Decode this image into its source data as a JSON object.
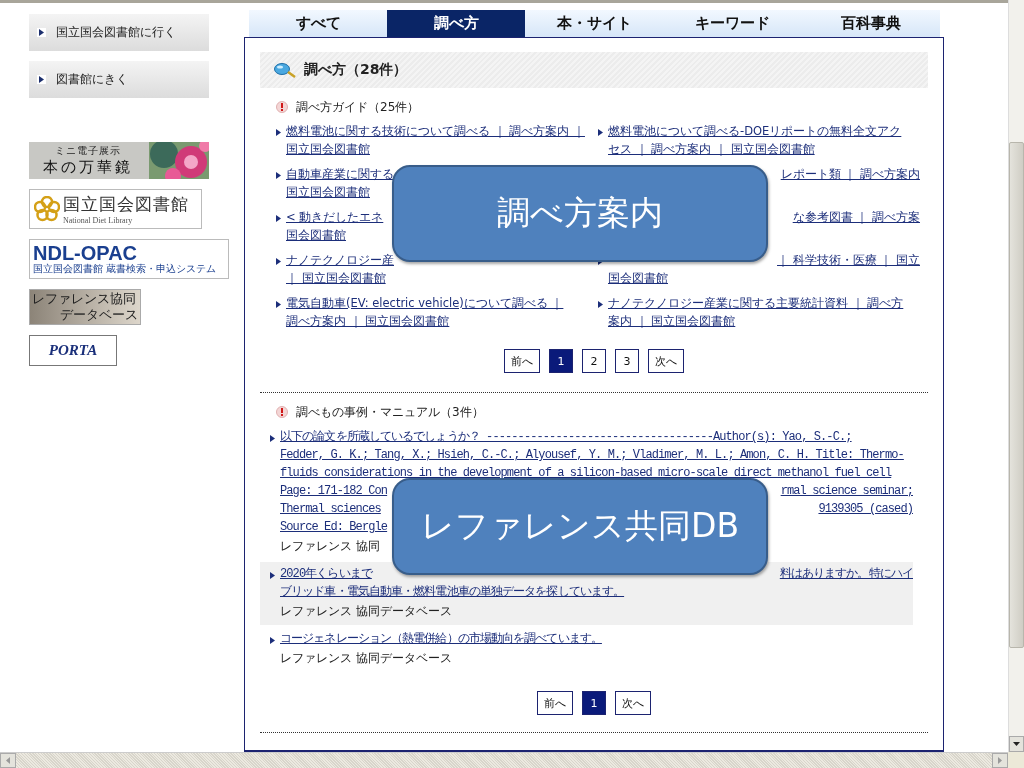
{
  "sidebar": {
    "buttons": [
      {
        "label": "国立国会図書館に行く"
      },
      {
        "label": "図書館にきく"
      }
    ],
    "banners": [
      {
        "kind": "exhibit",
        "texts": [
          "ミニ電子展示",
          "本の万華鏡"
        ]
      },
      {
        "kind": "ndl",
        "texts": [
          "国立国会図書館",
          "National Diet Library"
        ]
      },
      {
        "kind": "opac",
        "texts": [
          "NDL-OPAC",
          "国立国会図書館 蔵書検索・申込システム"
        ]
      },
      {
        "kind": "refdb",
        "texts": [
          "レファレンス協同",
          "データベース"
        ]
      },
      {
        "kind": "porta",
        "texts": [
          "PORTA"
        ]
      }
    ]
  },
  "tabs": [
    {
      "label": "すべて",
      "selected": false
    },
    {
      "label": "調べ方",
      "selected": true
    },
    {
      "label": "本・サイト",
      "selected": false
    },
    {
      "label": "キーワード",
      "selected": false
    },
    {
      "label": "百科事典",
      "selected": false
    }
  ],
  "results": {
    "heading": "調べ方（28件）",
    "sections": [
      {
        "kind": "guides",
        "title": "調べ方ガイド（25件）",
        "links": [
          {
            "lines": [
              {
                "head": "燃料電池に関する技術について調べる ｜ 調べ方案内 ｜"
              },
              {
                "head": "国立国会図書館"
              }
            ]
          },
          {
            "lines": [
              {
                "head": "燃料電池について調べる-DOEリポートの無料全文アク"
              },
              {
                "head": "セス ｜ 調べ方案内 ｜ 国立国会図書館"
              }
            ]
          },
          {
            "lines": [
              {
                "head": "自動車産業に関する"
              },
              {
                "head": "国立国会図書館"
              }
            ]
          },
          {
            "lines": [
              {
                "tail": "レポート類 ｜ 調べ方案内"
              }
            ]
          },
          {
            "lines": [
              {
                "head": "< 動きだしたエネ"
              },
              {
                "head": "国会図書館"
              }
            ]
          },
          {
            "lines": [
              {
                "tail": "な参考図書 ｜ 調べ方案"
              }
            ]
          },
          {
            "lines": [
              {
                "head": "ナノテクノロジー産"
              },
              {
                "head": "｜ 国立国会図書館"
              }
            ]
          },
          {
            "lines": [
              {
                "tail": "｜ 科学技術・医療 ｜ 国立"
              },
              {
                "head": "国会図書館"
              }
            ]
          },
          {
            "lines": [
              {
                "head": "電気自動車(EV: electric vehicle)について調べる ｜"
              },
              {
                "head": "調べ方案内 ｜ 国立国会図書館"
              }
            ]
          },
          {
            "lines": [
              {
                "head": "ナノテクノロジー産業に関する主要統計資料 ｜ 調べ方"
              },
              {
                "head": "案内 ｜ 国立国会図書館"
              }
            ]
          }
        ],
        "pages": [
          {
            "label": "前へ",
            "selected": false
          },
          {
            "label": "1",
            "selected": true
          },
          {
            "label": "2",
            "selected": false
          },
          {
            "label": "3",
            "selected": false
          },
          {
            "label": "次へ",
            "selected": false
          }
        ],
        "callout": "調べ方案内"
      },
      {
        "kind": "cases",
        "title": "調べもの事例・マニュアル（3件）",
        "links": [
          {
            "shaded": false,
            "lines": [
              {
                "head": "以下の論文を所蔵しているでしょうか？ ------------------------------------Author(s): Yao, S.-C.;"
              },
              {
                "head": "Fedder, G. K.; Tang, X.; Hsieh, C.-C.; Alyousef, Y. M.; Vladimer, M. L.; Amon, C. H. Title: Thermo-"
              },
              {
                "head": "fluids considerations in the development of a silicon-based micro-scale direct methanol fuel cell"
              },
              {
                "head": "Page: 171-182 Con",
                "tail": "rmal science seminar;"
              },
              {
                "head": "Thermal sciences",
                "tail": "9139305 (cased)"
              },
              {
                "head": "Source Ed: Bergle"
              }
            ],
            "source": "レファレンス 協同"
          },
          {
            "shaded": true,
            "lines": [
              {
                "head": "2020年くらいまで",
                "tail": "料はありますか。特にハイ"
              },
              {
                "head": "ブリッド車・電気自動車・燃料電池車の単独データを探しています。"
              }
            ],
            "source": "レファレンス 協同データベース"
          },
          {
            "shaded": false,
            "lines": [
              {
                "head": "コージェネレーション（熱電併給）の市場動向を調べています。"
              }
            ],
            "source": "レファレンス 協同データベース"
          }
        ],
        "pages": [
          {
            "label": "前へ",
            "selected": false
          },
          {
            "label": "1",
            "selected": true
          },
          {
            "label": "次へ",
            "selected": false
          }
        ],
        "callout": "レファレンス共同DB"
      }
    ]
  }
}
